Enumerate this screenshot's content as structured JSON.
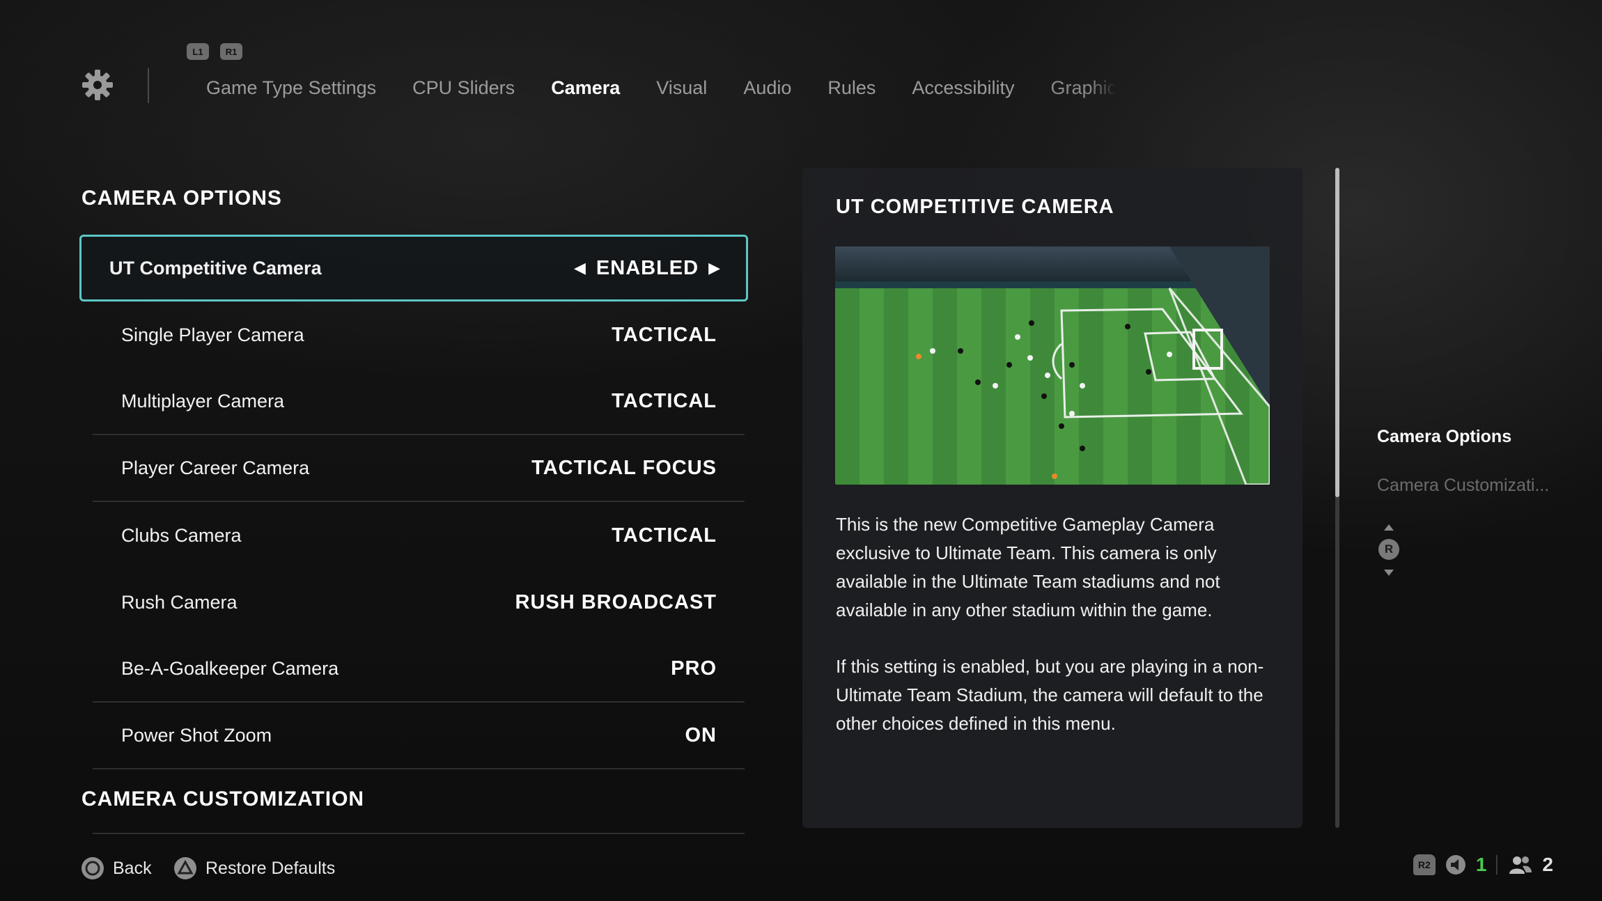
{
  "header": {
    "shoulder_left": "L1",
    "shoulder_right": "R1",
    "tabs": [
      {
        "label": "Game Type Settings"
      },
      {
        "label": "CPU Sliders"
      },
      {
        "label": "Camera"
      },
      {
        "label": "Visual"
      },
      {
        "label": "Audio"
      },
      {
        "label": "Rules"
      },
      {
        "label": "Accessibility"
      },
      {
        "label": "Graphic"
      }
    ],
    "active_tab": "Camera"
  },
  "camera_options": {
    "title": "CAMERA OPTIONS",
    "rows": [
      {
        "label": "UT Competitive Camera",
        "value": "ENABLED"
      },
      {
        "label": "Single Player Camera",
        "value": "TACTICAL"
      },
      {
        "label": "Multiplayer Camera",
        "value": "TACTICAL"
      },
      {
        "label": "Player Career Camera",
        "value": "TACTICAL FOCUS"
      },
      {
        "label": "Clubs Camera",
        "value": "TACTICAL"
      },
      {
        "label": "Rush Camera",
        "value": "RUSH BROADCAST"
      },
      {
        "label": "Be-A-Goalkeeper Camera",
        "value": "PRO"
      },
      {
        "label": "Power Shot Zoom",
        "value": "ON"
      }
    ]
  },
  "camera_customization": {
    "title": "CAMERA CUSTOMIZATION"
  },
  "detail_panel": {
    "title": "UT COMPETITIVE CAMERA",
    "paragraph1": "This is the new Competitive Gameplay Camera exclusive to Ultimate Team. This camera is only available in the Ultimate Team stadiums and not available in any other stadium within the game.",
    "paragraph2": "If this setting is enabled, but you are playing in a non-Ultimate Team Stadium, the camera will default to the other choices defined in this menu."
  },
  "side_nav": {
    "items": [
      {
        "label": "Camera Options"
      },
      {
        "label": "Camera Customizati..."
      }
    ],
    "stick_label": "R"
  },
  "footer": {
    "back_label": "Back",
    "restore_label": "Restore Defaults",
    "r2_label": "R2",
    "audio_count": "1",
    "players_count": "2"
  },
  "colors": {
    "selection_border": "#5ec7c7",
    "audio_count": "#4cc94c"
  }
}
